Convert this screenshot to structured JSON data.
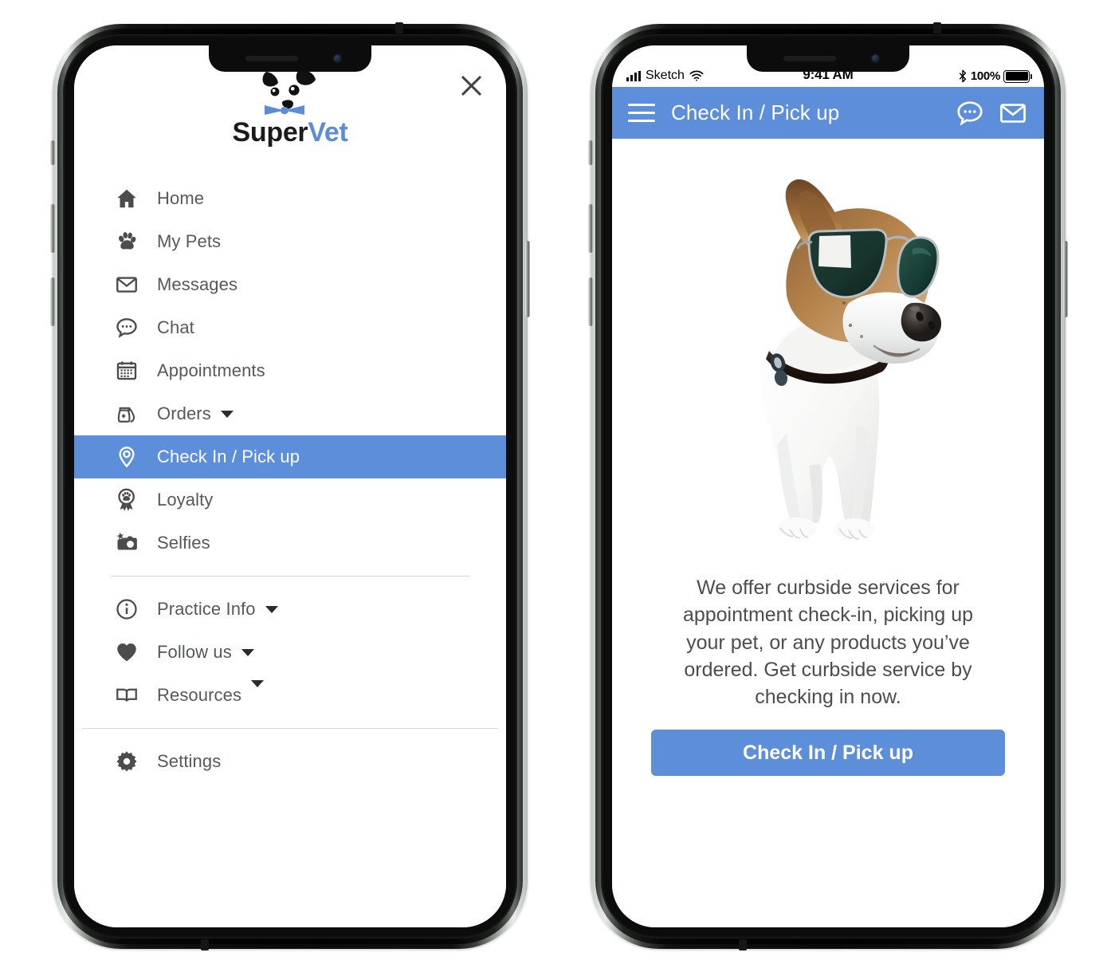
{
  "brand": {
    "name_prefix": "Super",
    "name_suffix": "Vet",
    "accent_color": "#5d8ed9",
    "logo_icon": "dog-face-with-bowtie-logo"
  },
  "left_phone": {
    "close_icon": "close-icon",
    "menu": [
      {
        "label": "Home",
        "icon": "home-icon",
        "caret": false,
        "active": false
      },
      {
        "label": "My Pets",
        "icon": "paw-icon",
        "caret": false,
        "active": false
      },
      {
        "label": "Messages",
        "icon": "envelope-icon",
        "caret": false,
        "active": false
      },
      {
        "label": "Chat",
        "icon": "chat-bubble-icon",
        "caret": false,
        "active": false
      },
      {
        "label": "Appointments",
        "icon": "calendar-icon",
        "caret": false,
        "active": false
      },
      {
        "label": "Orders",
        "icon": "food-bag-icon",
        "caret": true,
        "active": false
      },
      {
        "label": "Check In / Pick up",
        "icon": "map-pin-icon",
        "caret": false,
        "active": true
      },
      {
        "label": "Loyalty",
        "icon": "award-paw-icon",
        "caret": false,
        "active": false
      },
      {
        "label": "Selfies",
        "icon": "camera-star-icon",
        "caret": false,
        "active": false
      }
    ],
    "menu_secondary": [
      {
        "label": "Practice Info",
        "icon": "info-circle-icon",
        "caret": true
      },
      {
        "label": "Follow us",
        "icon": "heart-icon",
        "caret": true
      },
      {
        "label": "Resources",
        "icon": "book-icon",
        "caret": true,
        "caret_raised": true
      }
    ],
    "menu_footer": [
      {
        "label": "Settings",
        "icon": "gear-icon",
        "caret": false
      }
    ]
  },
  "right_phone": {
    "status_bar": {
      "carrier": "Sketch",
      "time": "9:41 AM",
      "battery_percent": "100%",
      "signal_icon": "cellular-bars-icon",
      "wifi_icon": "wifi-icon",
      "bluetooth_icon": "bluetooth-icon",
      "battery_icon": "battery-full-icon"
    },
    "app_bar": {
      "menu_icon": "hamburger-menu-icon",
      "title": "Check In / Pick up",
      "chat_icon": "chat-bubble-icon",
      "mail_icon": "envelope-icon"
    },
    "hero": {
      "alt": "jack-russell-terrier-wearing-green-aviator-sunglasses-with-black-collar"
    },
    "blurb": "We offer curbside services for appointment check-in, picking up your pet, or any products you’ve ordered. Get curbside service by checking in now.",
    "cta_label": "Check In / Pick up"
  }
}
